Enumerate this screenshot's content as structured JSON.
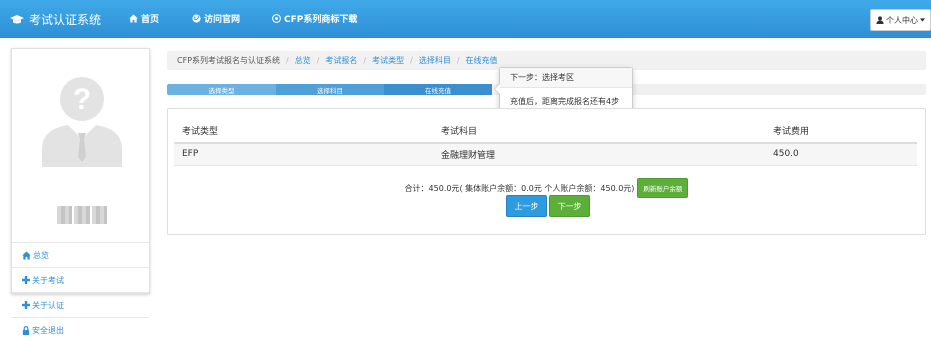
{
  "navbar": {
    "brand": "考试认证系统",
    "items": [
      {
        "label": "首页",
        "icon": "home-icon"
      },
      {
        "label": "访问官网",
        "icon": "globe-icon"
      },
      {
        "label": "CFP系列商标下载",
        "icon": "copyright-icon"
      }
    ],
    "user_menu": "个人中心"
  },
  "sidebar": {
    "menu": [
      {
        "label": "总览",
        "icon": "home-icon"
      },
      {
        "label": "关于考试",
        "icon": "plus-icon"
      },
      {
        "label": "关于认证",
        "icon": "plus-icon"
      },
      {
        "label": "安全退出",
        "icon": "lock-icon"
      }
    ]
  },
  "breadcrumb": {
    "root": "CFP系列考试报名与认证系统",
    "links": [
      "总览",
      "考试报名",
      "考试类型",
      "选择科目",
      "在线充值"
    ]
  },
  "progress": {
    "steps": [
      "选择类型",
      "选择科目",
      "在线充值"
    ],
    "completed": 3
  },
  "tooltip": {
    "title": "下一步：选择考区",
    "body": "充值后，距离完成报名还有4步"
  },
  "table": {
    "headers": [
      "考试类型",
      "考试科目",
      "考试费用"
    ],
    "rows": [
      [
        "EFP",
        "金融理财管理",
        "450.0"
      ]
    ]
  },
  "summary": {
    "text": "合计：450.0元( 集体账户余额：0.0元     个人账户余额：450.0元)",
    "refresh_label": "刷新账户余额"
  },
  "buttons": {
    "prev": "上一步",
    "next": "下一步"
  },
  "colors": {
    "navbar": "#2e8fd6",
    "primary": "#2e9ae0",
    "success": "#5cb039",
    "progress_active": "#5ea5d8"
  }
}
